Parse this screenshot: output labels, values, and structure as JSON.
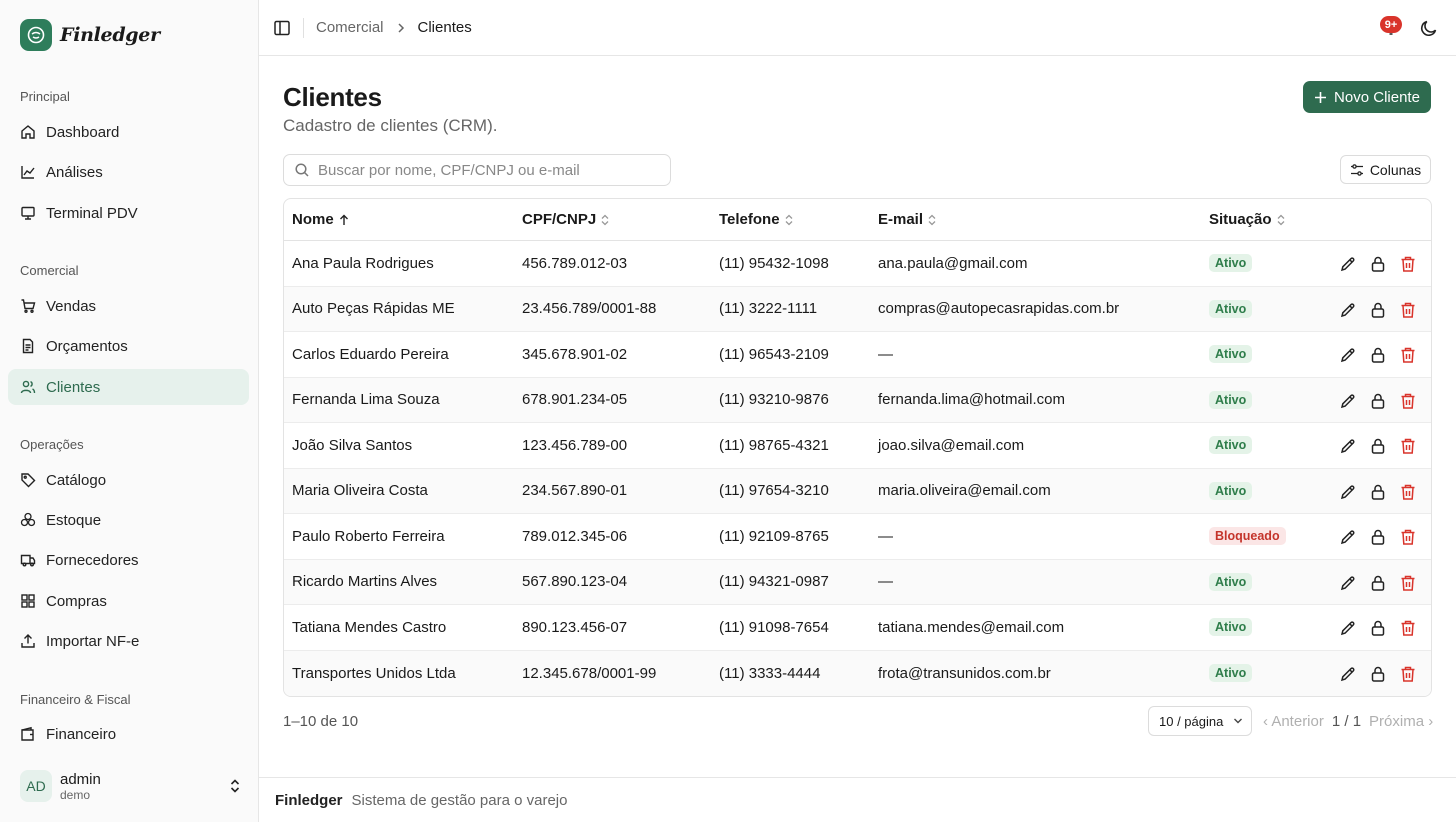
{
  "app": {
    "name": "Finledger"
  },
  "sidebar": {
    "groups": [
      {
        "label": "Principal",
        "items": [
          {
            "label": "Dashboard",
            "icon": "home-icon"
          },
          {
            "label": "Análises",
            "icon": "line-chart-icon"
          },
          {
            "label": "Terminal PDV",
            "icon": "monitor-icon"
          }
        ]
      },
      {
        "label": "Comercial",
        "items": [
          {
            "label": "Vendas",
            "icon": "cart-icon"
          },
          {
            "label": "Orçamentos",
            "icon": "document-icon"
          },
          {
            "label": "Clientes",
            "icon": "users-icon",
            "active": true
          }
        ]
      },
      {
        "label": "Operações",
        "items": [
          {
            "label": "Catálogo",
            "icon": "tag-icon"
          },
          {
            "label": "Estoque",
            "icon": "boxes-icon"
          },
          {
            "label": "Fornecedores",
            "icon": "truck-icon"
          },
          {
            "label": "Compras",
            "icon": "grid-icon"
          },
          {
            "label": "Importar NF-e",
            "icon": "upload-icon"
          }
        ]
      },
      {
        "label": "Financeiro & Fiscal",
        "items": [
          {
            "label": "Financeiro",
            "icon": "wallet-icon"
          }
        ]
      }
    ],
    "user": {
      "initials": "AD",
      "name": "admin",
      "org": "demo"
    }
  },
  "topbar": {
    "breadcrumb": [
      "Comercial",
      "Clientes"
    ],
    "notifications_badge": "9+"
  },
  "main": {
    "title": "Clientes",
    "subtitle": "Cadastro de clientes (CRM).",
    "new_button": "Novo Cliente",
    "search_placeholder": "Buscar por nome, CPF/CNPJ ou e-mail",
    "columns_button": "Colunas",
    "table": {
      "headers": [
        "Nome",
        "CPF/CNPJ",
        "Telefone",
        "E-mail",
        "Situação"
      ],
      "rows": [
        {
          "nome": "Ana Paula Rodrigues",
          "doc": "456.789.012-03",
          "tel": "(11) 95432-1098",
          "email": "ana.paula@gmail.com",
          "status": "Ativo"
        },
        {
          "nome": "Auto Peças Rápidas ME",
          "doc": "23.456.789/0001-88",
          "tel": "(11) 3222-1111",
          "email": "compras@autopecasrapidas.com.br",
          "status": "Ativo"
        },
        {
          "nome": "Carlos Eduardo Pereira",
          "doc": "345.678.901-02",
          "tel": "(11) 96543-2109",
          "email": "—",
          "status": "Ativo"
        },
        {
          "nome": "Fernanda Lima Souza",
          "doc": "678.901.234-05",
          "tel": "(11) 93210-9876",
          "email": "fernanda.lima@hotmail.com",
          "status": "Ativo"
        },
        {
          "nome": "João Silva Santos",
          "doc": "123.456.789-00",
          "tel": "(11) 98765-4321",
          "email": "joao.silva@email.com",
          "status": "Ativo"
        },
        {
          "nome": "Maria Oliveira Costa",
          "doc": "234.567.890-01",
          "tel": "(11) 97654-3210",
          "email": "maria.oliveira@email.com",
          "status": "Ativo"
        },
        {
          "nome": "Paulo Roberto Ferreira",
          "doc": "789.012.345-06",
          "tel": "(11) 92109-8765",
          "email": "—",
          "status": "Bloqueado"
        },
        {
          "nome": "Ricardo Martins Alves",
          "doc": "567.890.123-04",
          "tel": "(11) 94321-0987",
          "email": "—",
          "status": "Ativo"
        },
        {
          "nome": "Tatiana Mendes Castro",
          "doc": "890.123.456-07",
          "tel": "(11) 91098-7654",
          "email": "tatiana.mendes@email.com",
          "status": "Ativo"
        },
        {
          "nome": "Transportes Unidos Ltda",
          "doc": "12.345.678/0001-99",
          "tel": "(11) 3333-4444",
          "email": "frota@transunidos.com.br",
          "status": "Ativo"
        }
      ]
    },
    "pagination": {
      "range": "1–10 de 10",
      "per_page": "10 / página",
      "prev": "‹ Anterior",
      "page": "1 / 1",
      "next": "Próxima ›"
    }
  },
  "footer": {
    "brand": "Finledger",
    "tagline": "Sistema de gestão para o varejo"
  },
  "colors": {
    "accent": "#2e6b4f",
    "danger": "#d9342b",
    "active_bg": "#e6f1ec"
  }
}
